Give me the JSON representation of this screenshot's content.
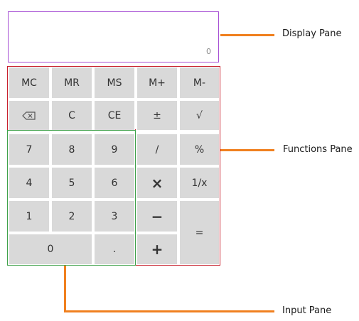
{
  "display": {
    "value": "0"
  },
  "keys": {
    "mc": "MC",
    "mr": "MR",
    "ms": "MS",
    "m_plus": "M+",
    "m_minus": "M-",
    "clear": "C",
    "clear_entry": "CE",
    "plus_minus": "±",
    "sqrt": "√",
    "seven": "7",
    "eight": "8",
    "nine": "9",
    "divide": "/",
    "percent": "%",
    "four": "4",
    "five": "5",
    "six": "6",
    "multiply": "×",
    "reciprocal": "1/x",
    "one": "1",
    "two": "2",
    "three": "3",
    "minus": "−",
    "equals": "=",
    "zero": "0",
    "decimal": ".",
    "plus": "+"
  },
  "icons": {
    "backspace": "backspace-icon"
  },
  "callouts": {
    "display_pane": "Display Pane",
    "functions_pane": "Functions Pane",
    "input_pane": "Input Pane"
  },
  "colors": {
    "display_border": "#a64ed4",
    "functions_border": "#c8202d",
    "input_border": "#3fa14a",
    "callout_line": "#f0801f",
    "key_background": "#d9d9d9"
  }
}
